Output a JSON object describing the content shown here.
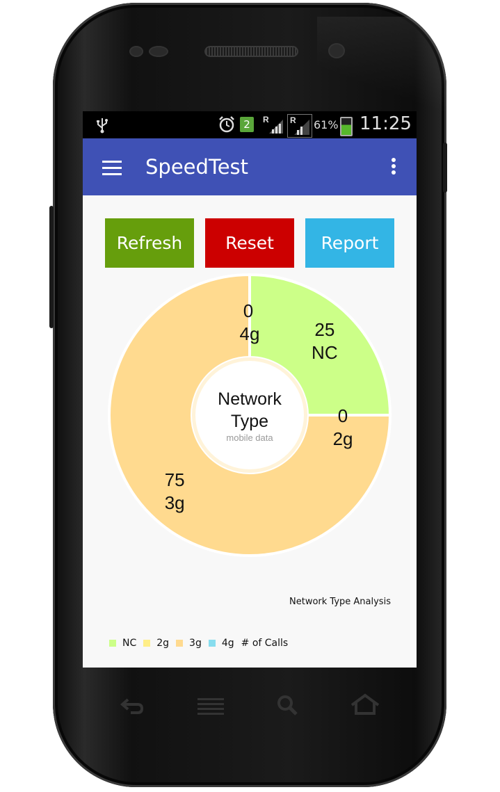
{
  "status_bar": {
    "notification_count": "2",
    "network_label": "R",
    "network_label_2": "R",
    "battery_percent": "61%",
    "time": "11:25"
  },
  "app_bar": {
    "title": "SpeedTest",
    "color": "#3f51b5"
  },
  "buttons": {
    "refresh_label": "Refresh",
    "reset_label": "Reset",
    "report_label": "Report"
  },
  "chart_data": {
    "type": "pie",
    "variant": "donut",
    "center_title_line1": "Network",
    "center_title_line2": "Type",
    "center_subtitle": "mobile data",
    "categories": [
      "NC",
      "2g",
      "3g",
      "4g"
    ],
    "values": [
      25,
      0,
      75,
      0
    ],
    "colors": [
      "#ccff88",
      "#ffee88",
      "#ffda8f",
      "#88ddee"
    ],
    "legend_title": "# of Calls",
    "legend_placement": "bottom-left",
    "caption": "Network Type Analysis"
  },
  "nav_icons": [
    "back-icon",
    "recent-apps-icon",
    "search-icon",
    "home-icon"
  ]
}
